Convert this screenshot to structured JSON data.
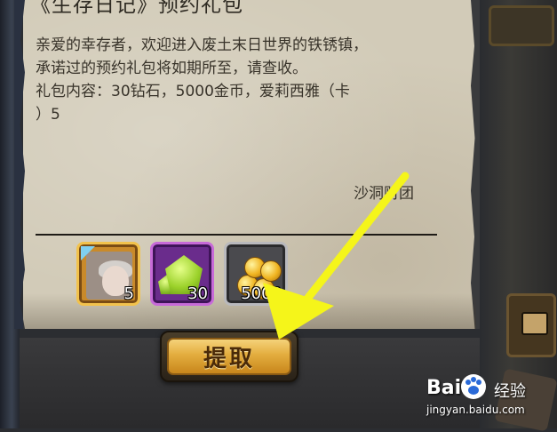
{
  "mail": {
    "title": "《生存日记》预约礼包",
    "body_lines": [
      "亲爱的幸存者，欢迎进入废土末日世界的铁锈镇，",
      "承诺过的预约礼包将如期所至，请查收。",
      "礼包内容：30钻石，5000金币，爱莉西雅（卡",
      "）5"
    ],
    "signature": "沙洞财团"
  },
  "rewards": [
    {
      "icon": "character-card-icon",
      "quantity": "5"
    },
    {
      "icon": "green-diamond-icon",
      "quantity": "30"
    },
    {
      "icon": "gold-coins-icon",
      "quantity": "5000"
    }
  ],
  "claim_button": {
    "label": "提取"
  },
  "watermark": {
    "logo": "Bai",
    "logo_suffix": "经验",
    "url": "jingyan.baidu.com"
  },
  "colors": {
    "parchment": "#d2cbb8",
    "arrow": "#f5f51a",
    "button_gold": "#e3ad3e",
    "card_frame": "#f2c24c",
    "diamond_frame": "#c76ad8",
    "gold_frame": "#b9b9bd"
  }
}
